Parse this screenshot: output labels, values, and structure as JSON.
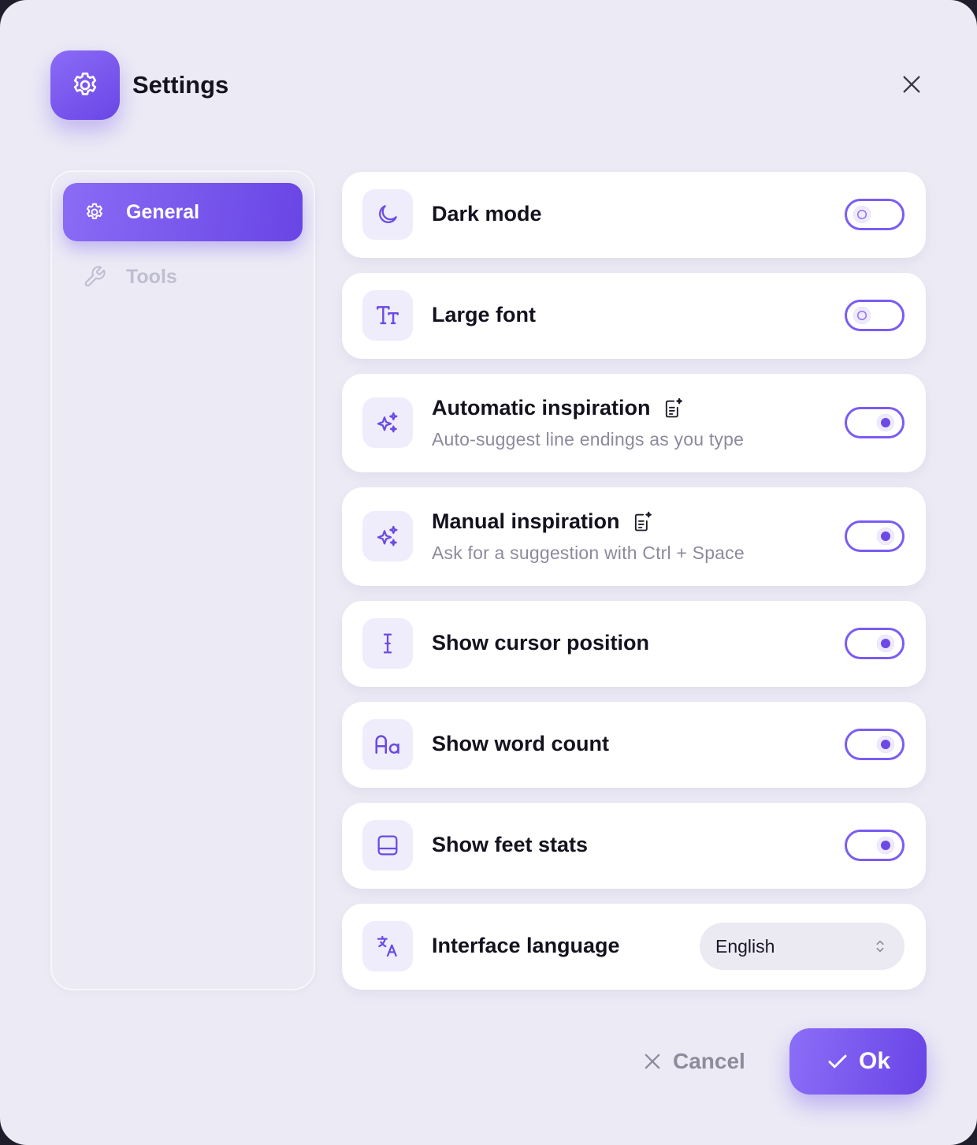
{
  "header": {
    "title": "Settings",
    "app_icon": "gear-icon",
    "close_icon": "close-icon"
  },
  "sidebar": {
    "items": [
      {
        "label": "General",
        "icon": "gear-icon",
        "active": true
      },
      {
        "label": "Tools",
        "icon": "wrench-icon",
        "active": false
      }
    ]
  },
  "settings": [
    {
      "label": "Dark mode",
      "icon": "moon-icon",
      "type": "toggle",
      "enabled": false
    },
    {
      "label": "Large font",
      "icon": "text-size-icon",
      "type": "toggle",
      "enabled": false
    },
    {
      "label": "Automatic inspiration",
      "description": "Auto-suggest line endings as you type",
      "icon": "sparkles-icon",
      "badge_icon": "ai-document-icon",
      "type": "toggle",
      "enabled": true
    },
    {
      "label": "Manual inspiration",
      "description": "Ask for a suggestion with Ctrl + Space",
      "icon": "sparkles-icon",
      "badge_icon": "ai-document-icon",
      "type": "toggle",
      "enabled": true
    },
    {
      "label": "Show cursor position",
      "icon": "text-cursor-icon",
      "type": "toggle",
      "enabled": true
    },
    {
      "label": "Show word count",
      "icon": "font-case-icon",
      "type": "toggle",
      "enabled": true
    },
    {
      "label": "Show feet stats",
      "icon": "panel-bottom-icon",
      "type": "toggle",
      "enabled": true
    },
    {
      "label": "Interface language",
      "icon": "translate-icon",
      "type": "select",
      "value": "English"
    }
  ],
  "footer": {
    "cancel_label": "Cancel",
    "ok_label": "Ok"
  },
  "colors": {
    "accent": "#7b5cf2",
    "background": "#ecebf5",
    "card": "#ffffff",
    "muted_text": "#8d8a9e"
  }
}
